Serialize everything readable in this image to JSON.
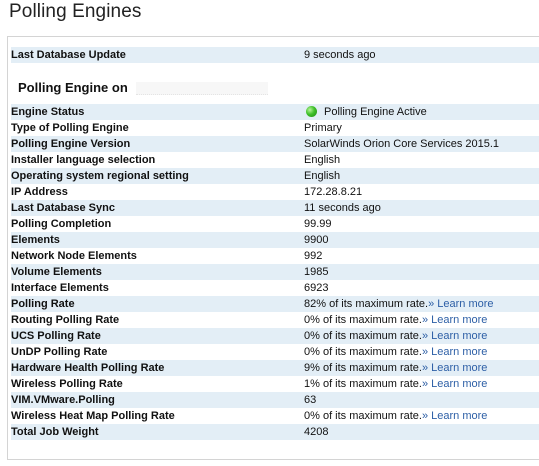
{
  "header": {
    "title": "Polling Engines"
  },
  "last_update": {
    "label": "Last Database Update",
    "value": "9 seconds ago"
  },
  "section": {
    "title": "Polling Engine on"
  },
  "rows": [
    {
      "label": "Engine Status",
      "value": "Polling Engine Active",
      "icon": "status-active-icon",
      "icon_color": "#40c02a"
    },
    {
      "label": "Type of Polling Engine",
      "value": "Primary"
    },
    {
      "label": "Polling Engine Version",
      "value": "SolarWinds Orion Core Services 2015.1"
    },
    {
      "label": "Installer language selection",
      "value": "English"
    },
    {
      "label": "Operating system regional setting",
      "value": "English"
    },
    {
      "label": "IP Address",
      "value": "172.28.8.21"
    },
    {
      "label": "Last Database Sync",
      "value": "11 seconds ago"
    },
    {
      "label": "Polling Completion",
      "value": "99.99"
    },
    {
      "label": "Elements",
      "value": "9900"
    },
    {
      "label": "Network Node Elements",
      "value": "992"
    },
    {
      "label": "Volume Elements",
      "value": "1985"
    },
    {
      "label": "Interface Elements",
      "value": "6923"
    },
    {
      "label": "Polling Rate",
      "value": "82% of its maximum rate.",
      "link": "» Learn more"
    },
    {
      "label": "Routing Polling Rate",
      "value": "0% of its maximum rate.",
      "link": "» Learn more"
    },
    {
      "label": "UCS Polling Rate",
      "value": "0% of its maximum rate.",
      "link": "» Learn more"
    },
    {
      "label": "UnDP Polling Rate",
      "value": "0% of its maximum rate.",
      "link": "» Learn more"
    },
    {
      "label": "Hardware Health Polling Rate",
      "value": "9% of its maximum rate.",
      "link": "» Learn more"
    },
    {
      "label": "Wireless Polling Rate",
      "value": "1% of its maximum rate.",
      "link": "» Learn more"
    },
    {
      "label": "VIM.VMware.Polling",
      "value": "63"
    },
    {
      "label": "Wireless Heat Map Polling Rate",
      "value": "0% of its maximum rate.",
      "link": "» Learn more"
    },
    {
      "label": "Total Job Weight",
      "value": "4208"
    }
  ],
  "colors": {
    "row_alt": "#e3eef6",
    "link": "#2d5fa6",
    "border": "#d4d4d4"
  }
}
